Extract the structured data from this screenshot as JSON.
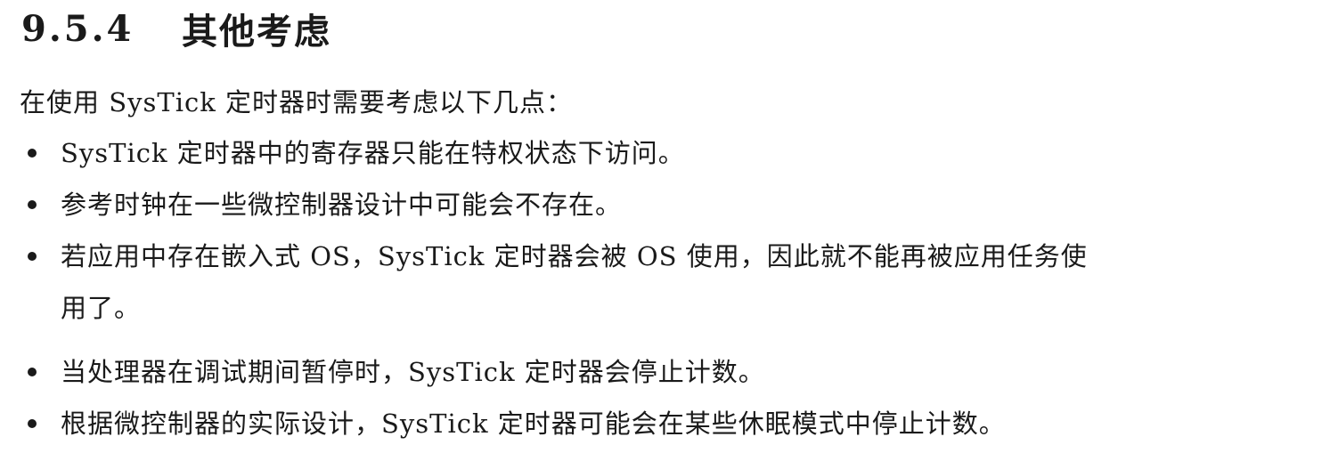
{
  "section": {
    "number": "9.5.4",
    "title": "其他考虑"
  },
  "intro": "在使用 SysTick 定时器时需要考虑以下几点：",
  "bullets": [
    {
      "text": "SysTick 定时器中的寄存器只能在特权状态下访问。"
    },
    {
      "text": "参考时钟在一些微控制器设计中可能会不存在。"
    },
    {
      "text": "若应用中存在嵌入式 OS，SysTick 定时器会被 OS 使用，因此就不能再被应用任务使",
      "continuation": "用了。"
    },
    {
      "text": "当处理器在调试期间暂停时，SysTick 定时器会停止计数。"
    },
    {
      "text": "根据微控制器的实际设计，SysTick 定时器可能会在某些休眠模式中停止计数。"
    }
  ]
}
